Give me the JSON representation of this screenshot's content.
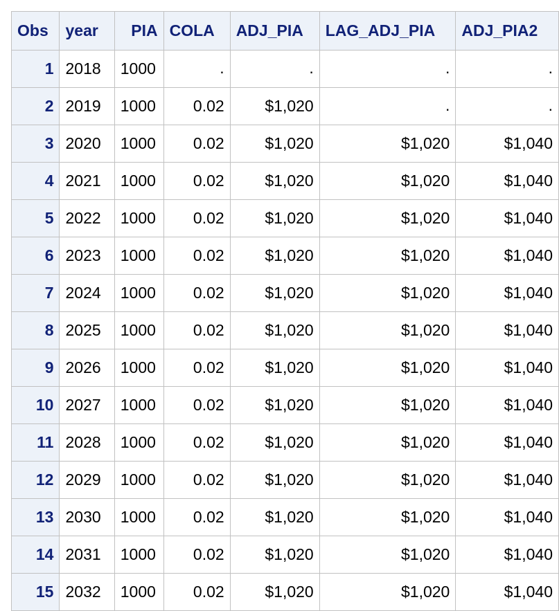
{
  "table": {
    "headers": [
      "Obs",
      "year",
      "PIA",
      "COLA",
      "ADJ_PIA",
      "LAG_ADJ_PIA",
      "ADJ_PIA2"
    ],
    "rows": [
      [
        "1",
        "2018",
        "1000",
        ".",
        ".",
        ".",
        "."
      ],
      [
        "2",
        "2019",
        "1000",
        "0.02",
        "$1,020",
        ".",
        "."
      ],
      [
        "3",
        "2020",
        "1000",
        "0.02",
        "$1,020",
        "$1,020",
        "$1,040"
      ],
      [
        "4",
        "2021",
        "1000",
        "0.02",
        "$1,020",
        "$1,020",
        "$1,040"
      ],
      [
        "5",
        "2022",
        "1000",
        "0.02",
        "$1,020",
        "$1,020",
        "$1,040"
      ],
      [
        "6",
        "2023",
        "1000",
        "0.02",
        "$1,020",
        "$1,020",
        "$1,040"
      ],
      [
        "7",
        "2024",
        "1000",
        "0.02",
        "$1,020",
        "$1,020",
        "$1,040"
      ],
      [
        "8",
        "2025",
        "1000",
        "0.02",
        "$1,020",
        "$1,020",
        "$1,040"
      ],
      [
        "9",
        "2026",
        "1000",
        "0.02",
        "$1,020",
        "$1,020",
        "$1,040"
      ],
      [
        "10",
        "2027",
        "1000",
        "0.02",
        "$1,020",
        "$1,020",
        "$1,040"
      ],
      [
        "11",
        "2028",
        "1000",
        "0.02",
        "$1,020",
        "$1,020",
        "$1,040"
      ],
      [
        "12",
        "2029",
        "1000",
        "0.02",
        "$1,020",
        "$1,020",
        "$1,040"
      ],
      [
        "13",
        "2030",
        "1000",
        "0.02",
        "$1,020",
        "$1,020",
        "$1,040"
      ],
      [
        "14",
        "2031",
        "1000",
        "0.02",
        "$1,020",
        "$1,020",
        "$1,040"
      ],
      [
        "15",
        "2032",
        "1000",
        "0.02",
        "$1,020",
        "$1,020",
        "$1,040"
      ]
    ]
  },
  "colors": {
    "header_background": "#edf2f9",
    "header_text": "#112277",
    "grid_border": "#c1c1c1",
    "cell_background": "#ffffff"
  }
}
